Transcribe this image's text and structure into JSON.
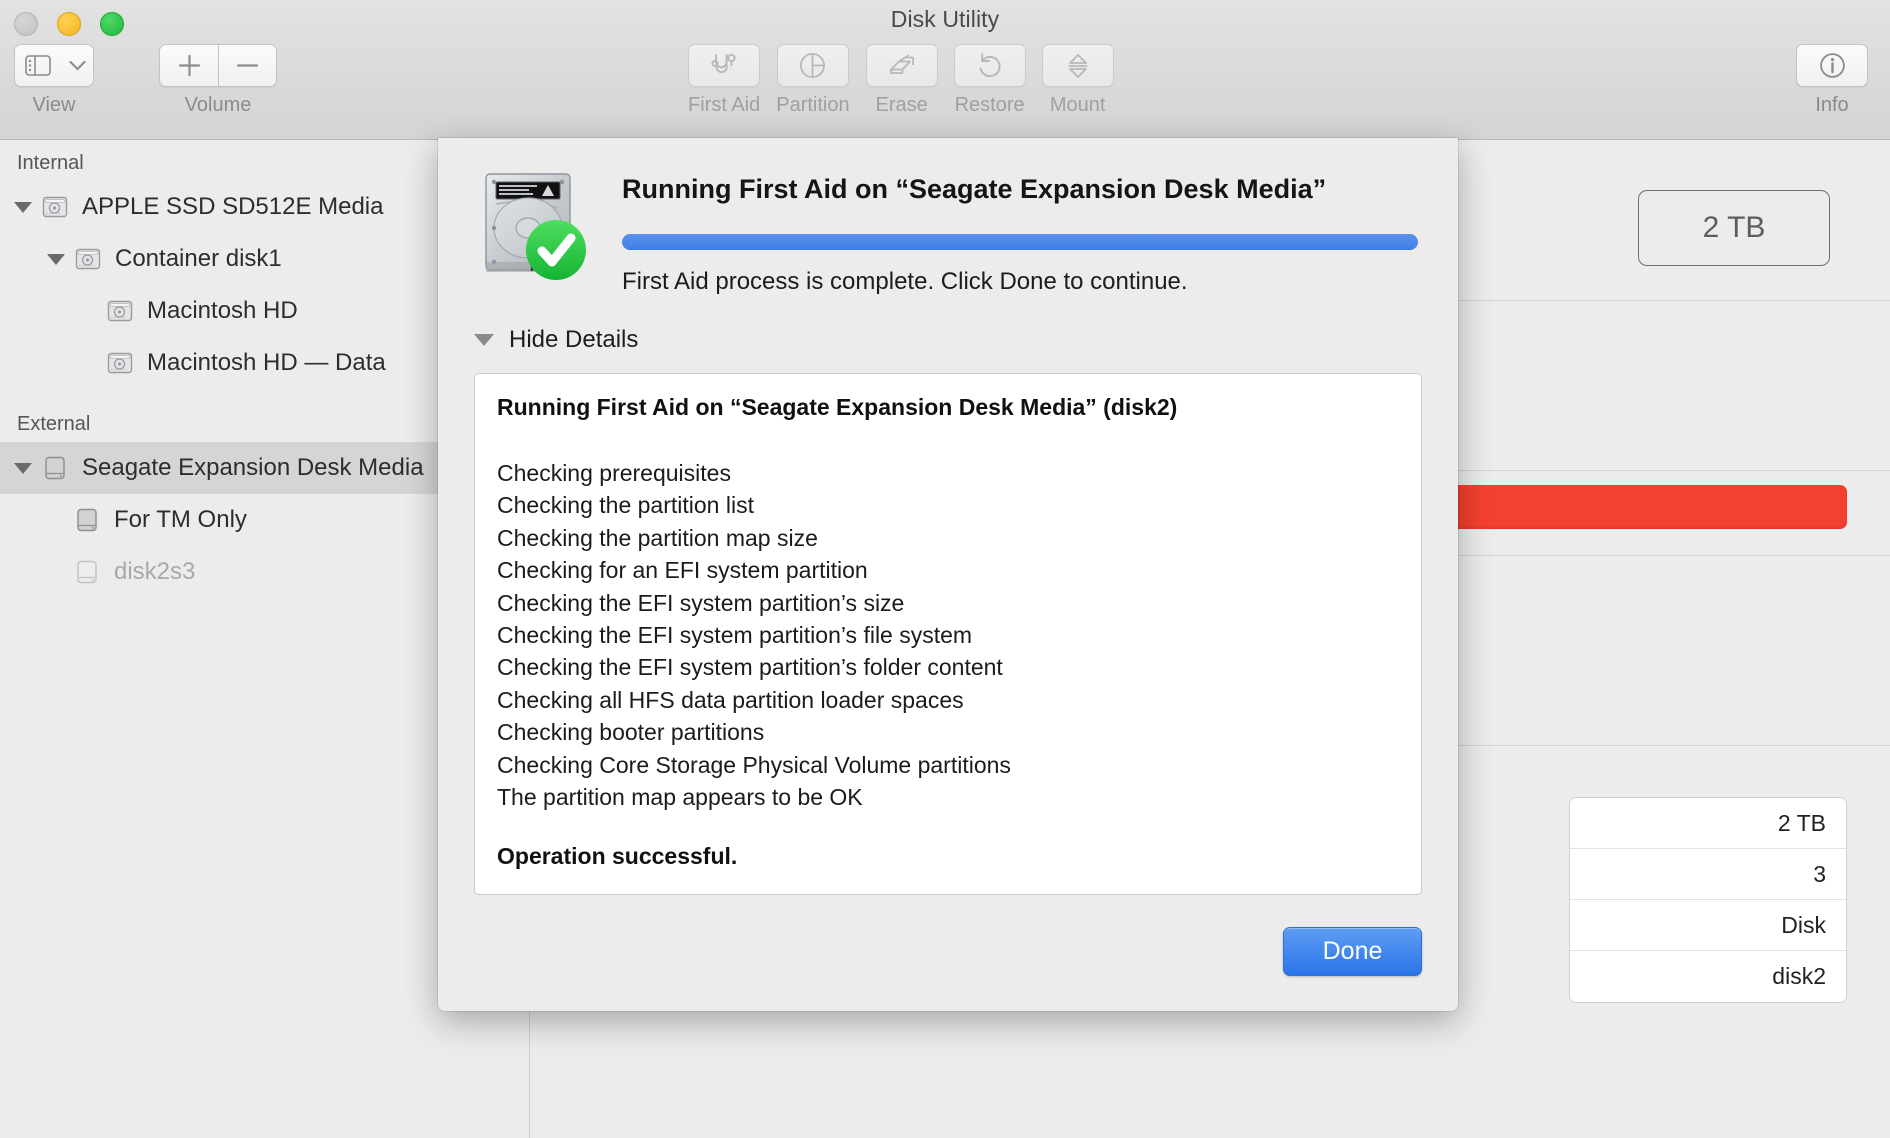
{
  "window": {
    "title": "Disk Utility",
    "traffic_lights": [
      "close",
      "minimize",
      "zoom"
    ]
  },
  "toolbar": {
    "view": {
      "label": "View",
      "icon": "sidebar-icon",
      "chevron": "chevron-down-icon"
    },
    "volume": {
      "label": "Volume",
      "add_icon": "plus-icon",
      "remove_icon": "minus-icon"
    },
    "actions": [
      {
        "label": "First Aid",
        "icon": "stethoscope-icon",
        "enabled": false
      },
      {
        "label": "Partition",
        "icon": "pie-chart-icon",
        "enabled": false
      },
      {
        "label": "Erase",
        "icon": "erase-icon",
        "enabled": false
      },
      {
        "label": "Restore",
        "icon": "undo-arrow-icon",
        "enabled": false
      },
      {
        "label": "Mount",
        "icon": "eject-icon",
        "enabled": false
      }
    ],
    "info": {
      "label": "Info",
      "icon": "info-circle-icon"
    }
  },
  "sidebar": {
    "sections": [
      {
        "title": "Internal",
        "rows": [
          {
            "label": "APPLE SSD SD512E Media",
            "indent": 0,
            "twisty": true,
            "icon": "internal-drive-icon",
            "selected": false,
            "dim": false
          },
          {
            "label": "Container disk1",
            "indent": 1,
            "twisty": true,
            "icon": "internal-drive-icon",
            "selected": false,
            "dim": false
          },
          {
            "label": "Macintosh HD",
            "indent": 2,
            "twisty": false,
            "icon": "internal-drive-icon",
            "selected": false,
            "dim": false
          },
          {
            "label": "Macintosh HD — Data",
            "indent": 2,
            "twisty": false,
            "icon": "internal-drive-icon",
            "selected": false,
            "dim": false
          }
        ]
      },
      {
        "title": "External",
        "rows": [
          {
            "label": "Seagate Expansion Desk Media",
            "indent": 0,
            "twisty": true,
            "icon": "external-drive-icon",
            "selected": true,
            "dim": false
          },
          {
            "label": "For TM Only",
            "indent": 1,
            "twisty": false,
            "icon": "external-drive-icon",
            "selected": false,
            "dim": false
          },
          {
            "label": "disk2",
            "indent": 1,
            "twisty": false,
            "icon": "external-drive-icon",
            "selected": false,
            "dim": true,
            "label_full": "disk2s3"
          }
        ]
      }
    ]
  },
  "detail": {
    "capacity_badge": "2 TB",
    "usage_bar_color": "#f4402f",
    "info_rows": [
      {
        "value": "2 TB"
      },
      {
        "value": "3"
      },
      {
        "value": "Disk"
      },
      {
        "value": "disk2"
      }
    ]
  },
  "sheet": {
    "disk_icon": "hard-disk-icon",
    "status_icon": "green-check-icon",
    "heading": "Running First Aid on “Seagate Expansion Desk Media”",
    "progress_percent": 100,
    "progress_color": "#3d7ee6",
    "subtitle": "First Aid process is complete. Click Done to continue.",
    "disclosure_label": "Hide Details",
    "log": {
      "title": "Running First Aid on “Seagate Expansion Desk Media” (disk2)",
      "lines": [
        "Checking prerequisites",
        "Checking the partition list",
        "Checking the partition map size",
        "Checking for an EFI system partition",
        "Checking the EFI system partition’s size",
        "Checking the EFI system partition’s file system",
        "Checking the EFI system partition’s folder content",
        "Checking all HFS data partition loader spaces",
        "Checking booter partitions",
        "Checking Core Storage Physical Volume partitions",
        "The partition map appears to be OK"
      ],
      "final": "Operation successful."
    },
    "done_label": "Done"
  }
}
